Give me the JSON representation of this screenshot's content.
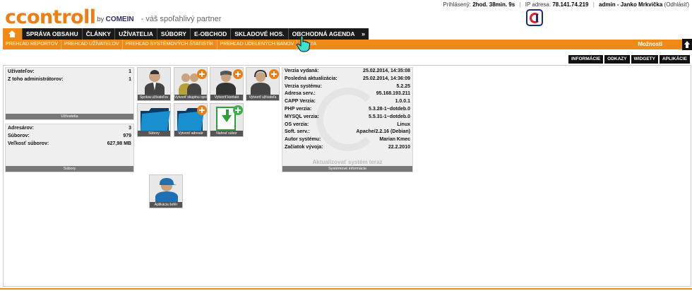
{
  "header": {
    "logo_word": "ccontroll",
    "logo_by": "by",
    "logo_brand": "COMEIN",
    "tagline": "- váš spoľahlivý partner",
    "logged_label": "Prihlásený:",
    "logged_value": "2hod. 38min. 9s",
    "ip_label": "IP adresa:",
    "ip_value": "78.141.74.219",
    "user": "admin - Janko Mrkvička",
    "logout": "(Odhlásiť)"
  },
  "mainnav": {
    "items": [
      "SPRÁVA OBSAHU",
      "ČLÁNKY",
      "UŽÍVATELIA",
      "SÚBORY",
      "E-OBCHOD",
      "SKLADOVÉ HOS.",
      "OBCHODNÁ AGENDA"
    ],
    "more": "»"
  },
  "subnav": {
    "items": [
      "PREHĽAD REPORTOV",
      "PREHĽAD UŽÍVATEĽOV",
      "PREHĽAD SYSTÉMOVÝCH ŠTATISTÍK",
      "PREHĽAD UDELENÝCH BANOV",
      "NASTA"
    ],
    "options": "Možnosti"
  },
  "tabs": [
    "INFORMÁCIE",
    "ODKAZY",
    "WIDGETY",
    "APLIKÁCIE"
  ],
  "users_box": {
    "rows": [
      {
        "label": "Užívateľov:",
        "value": "1"
      },
      {
        "label": "Z toho administrátorov:",
        "value": "1"
      }
    ],
    "footer": "Užívatelia"
  },
  "files_box": {
    "rows": [
      {
        "label": "Adresárov:",
        "value": "3"
      },
      {
        "label": "Súborov:",
        "value": "979"
      },
      {
        "label": "Veľkosť súborov:",
        "value": "627,98 MB"
      }
    ],
    "footer": "Súbory"
  },
  "sys_box": {
    "rows": [
      {
        "label": "Verzia vydaná:",
        "value": "25.02.2014, 14:35:08"
      },
      {
        "label": "Posledná aktualizácia:",
        "value": "25.02.2014, 14:36:09"
      },
      {
        "label": "Verzia systému:",
        "value": "5.2.25"
      },
      {
        "label": "Adresa serv.:",
        "value": "95.168.193.211"
      },
      {
        "label": "CAPP Verzia:",
        "value": "1.0.0.1"
      },
      {
        "label": "PHP verzia:",
        "value": "5.3.28-1~dotdeb.0"
      },
      {
        "label": "MYSQL verzia:",
        "value": "5.5.31-1~dotdeb.0"
      },
      {
        "label": "OS verzia:",
        "value": "Linux"
      },
      {
        "label": "Soft. serv.:",
        "value": "Apache/2.2.16 (Debian)"
      },
      {
        "label": "Autor systému:",
        "value": "Marian Kmec"
      },
      {
        "label": "Začiatok vývoja:",
        "value": "22.2.2010"
      }
    ],
    "update": "Aktualizovať systém teraz",
    "footer": "Systémové informácie"
  },
  "tiles": [
    {
      "caption": "Správa užívateľov",
      "icon": "user-icon"
    },
    {
      "caption": "Vytvoriť skupinu oprávnení",
      "icon": "user-group-add-icon"
    },
    {
      "caption": "Vytvoriť kontakt",
      "icon": "contact-add-icon"
    },
    {
      "caption": "Vytvoriť užívateľa",
      "icon": "user-add-icon"
    },
    {
      "caption": "Súbory",
      "icon": "folder-icon"
    },
    {
      "caption": "Vytvoriť adresár",
      "icon": "folder-add-icon"
    },
    {
      "caption": "Nahrať súbor",
      "icon": "upload-icon"
    },
    {
      "caption": "Aplikácia šofér",
      "icon": "driver-icon"
    }
  ],
  "colors": {
    "accent": "#f08a16",
    "dark": "#1a1a1a"
  }
}
